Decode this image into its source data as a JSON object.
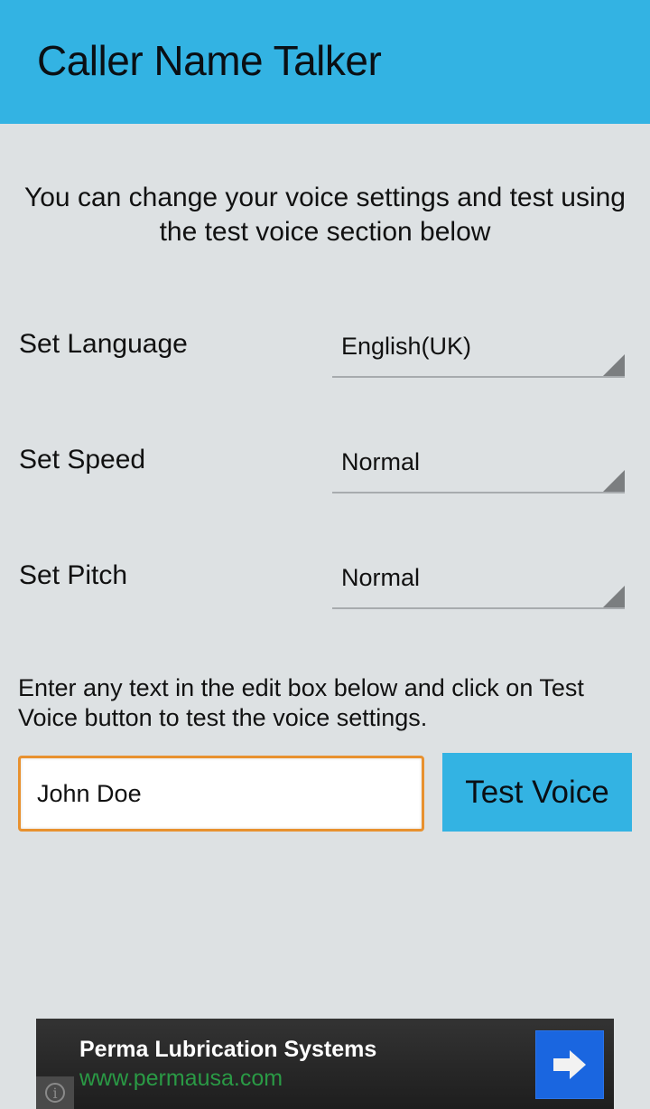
{
  "app": {
    "title": "Caller Name Talker",
    "accent_color": "#33b3e3"
  },
  "intro_text": "You can change your voice settings and test using the test voice section below",
  "settings": [
    {
      "label": "Set Language",
      "value": "English(UK)"
    },
    {
      "label": "Set Speed",
      "value": "Normal"
    },
    {
      "label": "Set Pitch",
      "value": "Normal"
    }
  ],
  "test_section": {
    "hint": "Enter any text in the edit box below and click on Test Voice button to test the voice settings.",
    "input_value": "John Doe",
    "button_label": "Test Voice"
  },
  "ad": {
    "headline": "Perma Lubrication Systems",
    "url": "www.permausa.com",
    "go_icon": "arrow-right-icon",
    "info_icon": "info-icon",
    "info_glyph": "i"
  }
}
